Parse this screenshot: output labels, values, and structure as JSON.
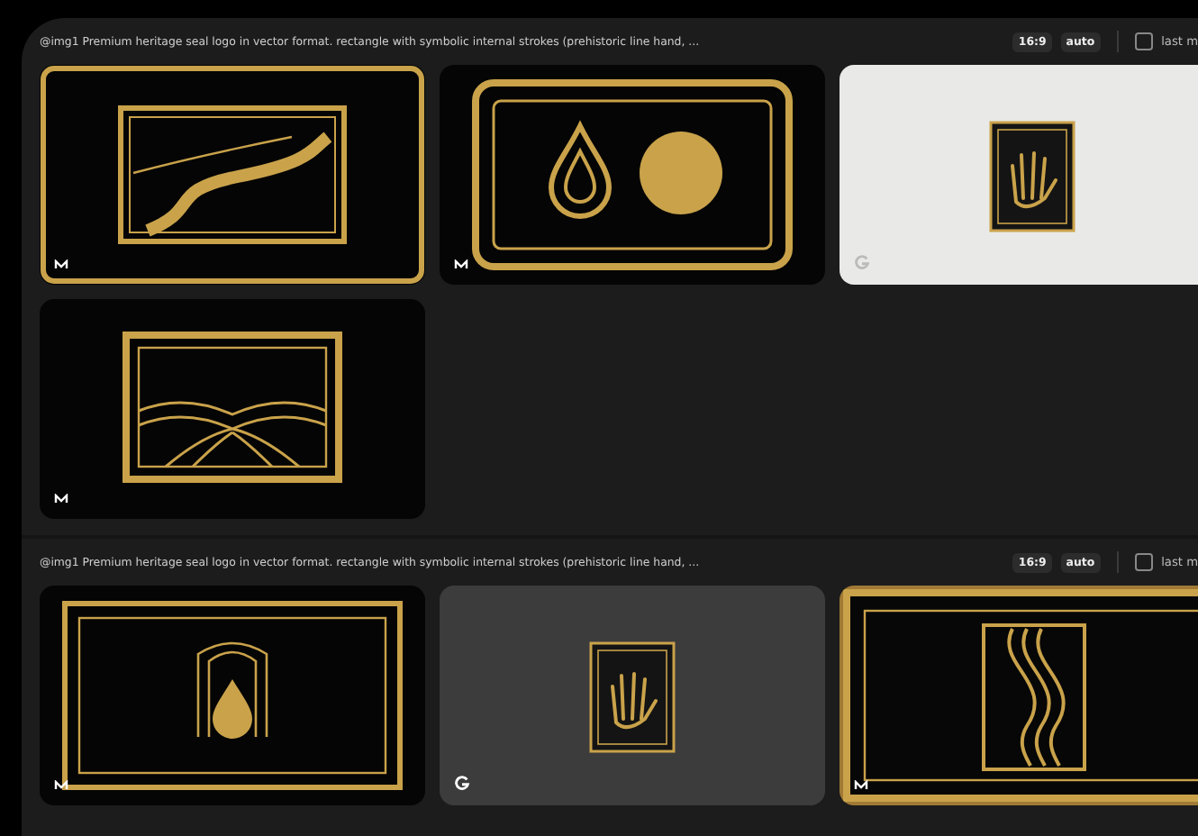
{
  "sections": [
    {
      "prompt": "@img1 Premium heritage seal logo in vector format. rectangle with symbolic internal strokes (prehistoric line hand, ...",
      "ratio": "16:9",
      "quality": "auto",
      "checkbox": {
        "label": "last m",
        "checked": false
      },
      "images": [
        {
          "kind": "river"
        },
        {
          "kind": "drop-sun"
        },
        {
          "kind": "hand-print"
        },
        {
          "kind": "fields"
        }
      ]
    },
    {
      "prompt": "@img1 Premium heritage seal logo in vector format. rectangle with symbolic internal strokes (prehistoric line hand, ...",
      "ratio": "16:9",
      "quality": "auto",
      "checkbox": {
        "label": "last m",
        "checked": false
      },
      "images": [
        {
          "kind": "drop-rays"
        },
        {
          "kind": "hand-card"
        },
        {
          "kind": "wave"
        }
      ]
    }
  ]
}
